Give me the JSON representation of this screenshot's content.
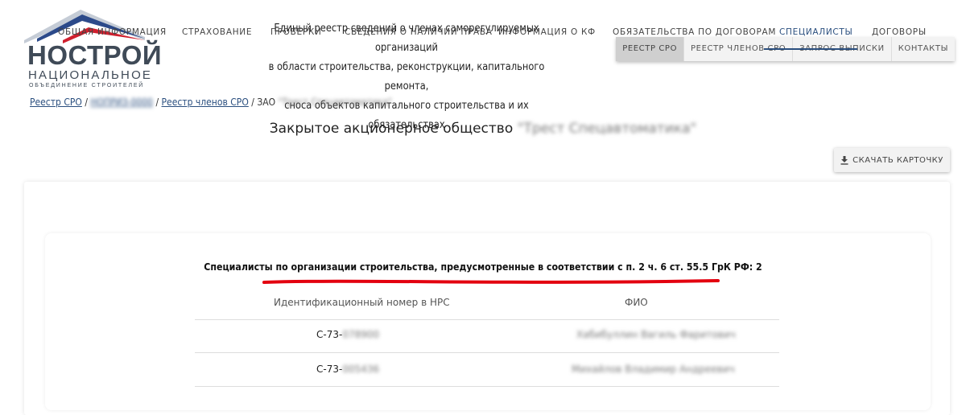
{
  "logo": {
    "name": "НОСТРОЙ",
    "subtitle": "НАЦИОНАЛЬНОЕ",
    "subtitle2": "ОБЪЕДИНЕНИЕ СТРОИТЕЛЕЙ"
  },
  "header": {
    "line1": "Единый реестр сведений о членах саморегулируемых организаций",
    "line2": "в области строительства, реконструкции, капитального ремонта,",
    "line3": "сноса объектов капитального строительства и их обязательствах"
  },
  "topnav": {
    "items": [
      "РЕЕСТР СРО",
      "РЕЕСТР ЧЛЕНОВ СРО",
      "ЗАПРОС ВЫПИСКИ",
      "КОНТАКТЫ"
    ]
  },
  "breadcrumb": {
    "root": "Реестр СРО",
    "sep": " / ",
    "members": "Реестр членов СРО",
    "current_prefix": "ЗАО"
  },
  "page": {
    "title": "Закрытое акционерное общество"
  },
  "download": {
    "label": "СКАЧАТЬ КАРТОЧКУ",
    "icon": "download-icon"
  },
  "tabs": [
    "ОБЩАЯ ИНФОРМАЦИЯ",
    "СТРАХОВАНИЕ",
    "ПРОВЕРКИ",
    "СВЕДЕНИЯ О НАЛИЧИИ ПРАВА",
    "ИНФОРМАЦИЯ О КФ",
    "ОБЯЗАТЕЛЬСТВА ПО ДОГОВОРАМ",
    "СПЕЦИАЛИСТЫ",
    "ДОГОВОРЫ"
  ],
  "active_tab": "СПЕЦИАЛИСТЫ",
  "specialists": {
    "heading": "Специалисты по организации строительства, предусмотренные в соответствии с п. 2 ч. 6 ст. 55.5 ГрК РФ: 2",
    "columns": [
      "Идентификационный номер в НРС",
      "ФИО"
    ],
    "rows": [
      {
        "id": "С-73-"
      },
      {
        "id": "С-73-"
      }
    ]
  },
  "colors": {
    "accent": "#2b4f7f",
    "underline_red": "#e3000f",
    "logo_text": "#3f4a57"
  }
}
